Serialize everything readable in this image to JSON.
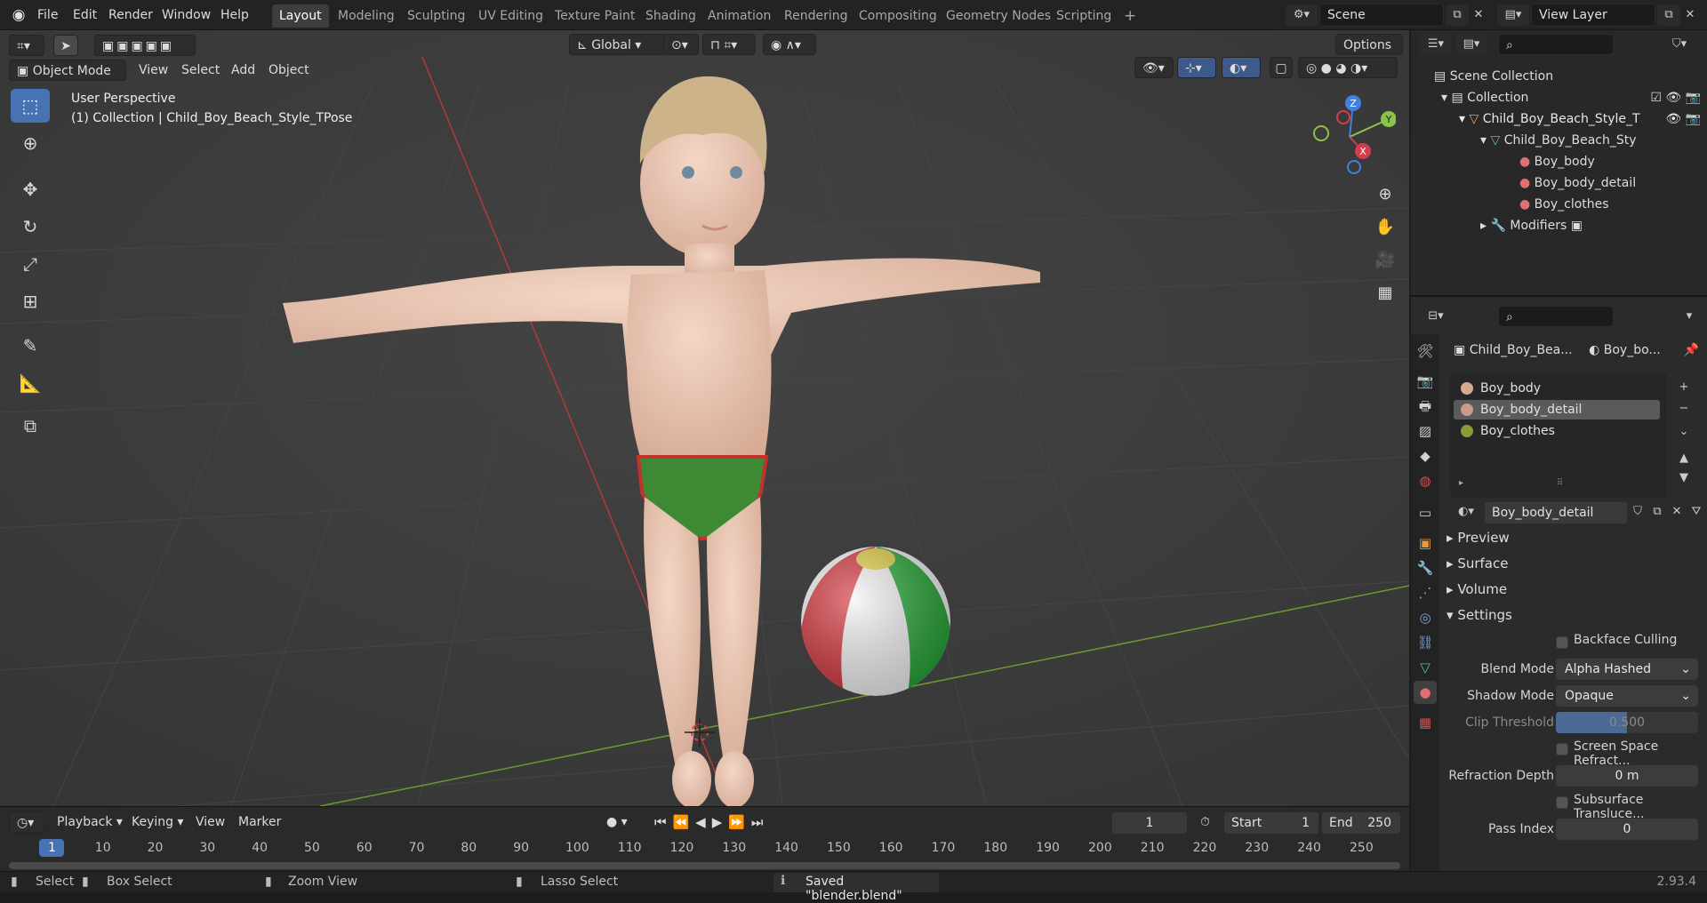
{
  "app": {
    "version": "2.93.4"
  },
  "menu": [
    "File",
    "Edit",
    "Render",
    "Window",
    "Help"
  ],
  "workspaces": [
    "Layout",
    "Modeling",
    "Sculpting",
    "UV Editing",
    "Texture Paint",
    "Shading",
    "Animation",
    "Rendering",
    "Compositing",
    "Geometry Nodes",
    "Scripting"
  ],
  "active_workspace": "Layout",
  "topbar": {
    "scene": "Scene",
    "view_layer": "View Layer"
  },
  "viewport": {
    "mode": "Object Mode",
    "menus": [
      "View",
      "Select",
      "Add",
      "Object"
    ],
    "orientation": "Global",
    "options": "Options",
    "info_line1": "User Perspective",
    "info_line2": "(1) Collection | Child_Boy_Beach_Style_TPose",
    "gizmo": {
      "x": "X",
      "y": "Y",
      "z": "Z"
    }
  },
  "outliner": {
    "scene_collection": "Scene Collection",
    "collection": "Collection",
    "object": "Child_Boy_Beach_Style_T",
    "mesh": "Child_Boy_Beach_Sty",
    "materials": [
      "Boy_body",
      "Boy_body_detail",
      "Boy_clothes"
    ],
    "modifiers": "Modifiers"
  },
  "properties": {
    "breadcrumb_object": "Child_Boy_Bea...",
    "breadcrumb_material": "Boy_bo...",
    "slots": [
      "Boy_body",
      "Boy_body_detail",
      "Boy_clothes"
    ],
    "selected_slot": 1,
    "material_name": "Boy_body_detail",
    "sections": {
      "preview": "Preview",
      "surface": "Surface",
      "volume": "Volume",
      "settings": "Settings"
    },
    "settings": {
      "backface_culling": "Backface Culling",
      "blend_mode_label": "Blend Mode",
      "blend_mode": "Alpha Hashed",
      "shadow_mode_label": "Shadow Mode",
      "shadow_mode": "Opaque",
      "clip_threshold_label": "Clip Threshold",
      "clip_threshold": "0.500",
      "ssr": "Screen Space Refract...",
      "refraction_depth_label": "Refraction Depth",
      "refraction_depth": "0 m",
      "subsurface": "Subsurface Transluce...",
      "pass_index_label": "Pass Index",
      "pass_index": "0"
    }
  },
  "timeline": {
    "menus": [
      "Playback",
      "Keying",
      "View",
      "Marker"
    ],
    "current_frame": "1",
    "start_label": "Start",
    "start": "1",
    "end_label": "End",
    "end": "250",
    "ticks": [
      "1",
      "10",
      "20",
      "30",
      "40",
      "50",
      "60",
      "70",
      "80",
      "90",
      "100",
      "110",
      "120",
      "130",
      "140",
      "150",
      "160",
      "170",
      "180",
      "190",
      "200",
      "210",
      "220",
      "230",
      "240",
      "250"
    ]
  },
  "status": {
    "select": "Select",
    "box_select": "Box Select",
    "zoom_view": "Zoom View",
    "lasso_select": "Lasso Select",
    "message": "Saved \"blender.blend\""
  },
  "colors": {
    "accent": "#4772b3",
    "x_axis": "#d23d4a",
    "y_axis": "#8bc34a",
    "z_axis": "#3f80e0"
  }
}
